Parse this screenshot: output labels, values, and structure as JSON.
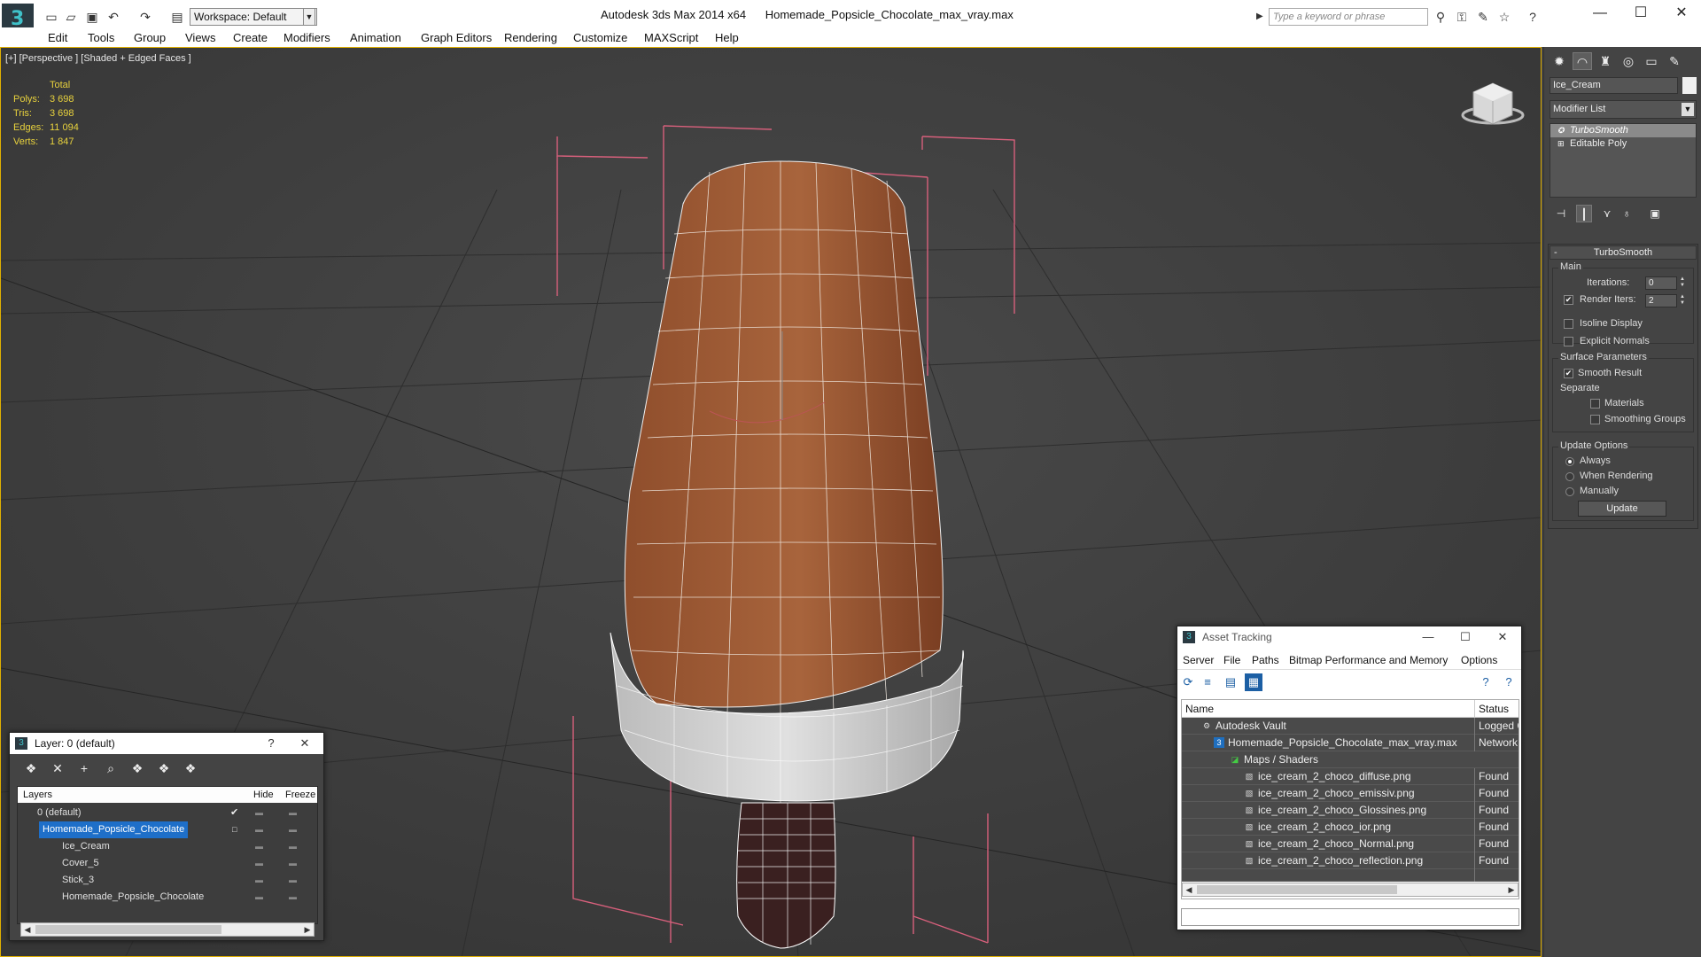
{
  "titlebar": {
    "app": "Autodesk 3ds Max  2014 x64",
    "file": "Homemade_Popsicle_Chocolate_max_vray.max",
    "workspace": "Workspace: Default",
    "search_placeholder": "Type a keyword or phrase"
  },
  "menu": [
    "Edit",
    "Tools",
    "Group",
    "Views",
    "Create",
    "Modifiers",
    "Animation",
    "Graph Editors",
    "Rendering",
    "Customize",
    "MAXScript",
    "Help"
  ],
  "viewport": {
    "label": "[+] [Perspective ] [Shaded + Edged Faces ]",
    "stats": {
      "header": "Total",
      "rows": [
        {
          "label": "Polys:",
          "value": "3 698"
        },
        {
          "label": "Tris:",
          "value": "3 698"
        },
        {
          "label": "Edges:",
          "value": "11 094"
        },
        {
          "label": "Verts:",
          "value": "1 847"
        }
      ]
    }
  },
  "command_panel": {
    "object_name": "Ice_Cream",
    "modifier_list": "Modifier List",
    "stack": [
      "TurboSmooth",
      "Editable Poly"
    ],
    "rollout_title": "TurboSmooth",
    "main_group": "Main",
    "iterations_label": "Iterations:",
    "iterations_value": "0",
    "render_iters_label": "Render Iters:",
    "render_iters_value": "2",
    "isoline_display": "Isoline Display",
    "explicit_normals": "Explicit Normals",
    "surface_params": "Surface Parameters",
    "smooth_result": "Smooth Result",
    "separate": "Separate",
    "materials": "Materials",
    "smoothing_groups": "Smoothing Groups",
    "update_options": "Update Options",
    "always": "Always",
    "when_rendering": "When Rendering",
    "manually": "Manually",
    "update_button": "Update"
  },
  "layer_dialog": {
    "title": "Layer: 0 (default)",
    "help": "?",
    "columns": {
      "layers": "Layers",
      "hide": "Hide",
      "freeze": "Freeze"
    },
    "rows": [
      {
        "name": "0 (default)"
      },
      {
        "name": "Homemade_Popsicle_Chocolate"
      },
      {
        "name": "Ice_Cream"
      },
      {
        "name": "Cover_5"
      },
      {
        "name": "Stick_3"
      },
      {
        "name": "Homemade_Popsicle_Chocolate"
      }
    ]
  },
  "asset_tracking": {
    "title": "Asset Tracking",
    "menu": [
      "Server",
      "File",
      "Paths",
      "Bitmap Performance and Memory",
      "Options"
    ],
    "columns": {
      "name": "Name",
      "status": "Status"
    },
    "rows": [
      {
        "name": "Autodesk Vault",
        "status": "Logged Out"
      },
      {
        "name": "Homemade_Popsicle_Chocolate_max_vray.max",
        "status": "Network"
      },
      {
        "name": "Maps / Shaders",
        "status": ""
      },
      {
        "name": "ice_cream_2_choco_diffuse.png",
        "status": "Found"
      },
      {
        "name": "ice_cream_2_choco_emissiv.png",
        "status": "Found"
      },
      {
        "name": "ice_cream_2_choco_Glossines.png",
        "status": "Found"
      },
      {
        "name": "ice_cream_2_choco_ior.png",
        "status": "Found"
      },
      {
        "name": "ice_cream_2_choco_Normal.png",
        "status": "Found"
      },
      {
        "name": "ice_cream_2_choco_reflection.png",
        "status": "Found"
      }
    ]
  },
  "colors": {
    "chocolate": "#8a4a2a",
    "cover": "#c8c8c8",
    "stick": "#3a2020",
    "selection_box": "#e0607a",
    "viewport_border": "#e0b000"
  }
}
